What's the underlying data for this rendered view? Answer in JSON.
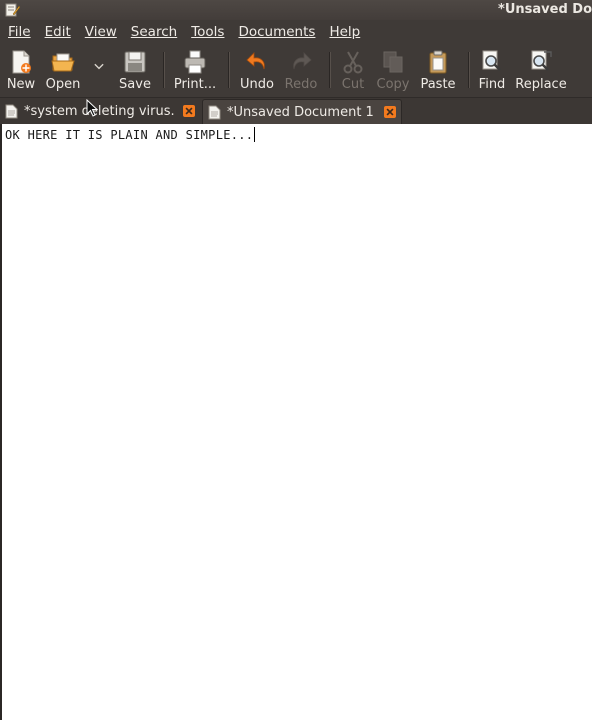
{
  "window": {
    "title": "*Unsaved Do"
  },
  "menu": [
    "File",
    "Edit",
    "View",
    "Search",
    "Tools",
    "Documents",
    "Help"
  ],
  "toolbar": {
    "new": "New",
    "open": "Open",
    "save": "Save",
    "print": "Print...",
    "undo": "Undo",
    "redo": "Redo",
    "cut": "Cut",
    "copy": "Copy",
    "paste": "Paste",
    "find": "Find",
    "replace": "Replace"
  },
  "tabs": [
    {
      "label": "*system deleting virus.",
      "active": false
    },
    {
      "label": "*Unsaved Document 1",
      "active": true
    }
  ],
  "editor": {
    "text": "OK HERE IT IS PLAIN AND SIMPLE..."
  },
  "colors": {
    "accent": "#f37a1e",
    "chrome": "#3f3a37",
    "editor_bg": "#ffffff"
  }
}
